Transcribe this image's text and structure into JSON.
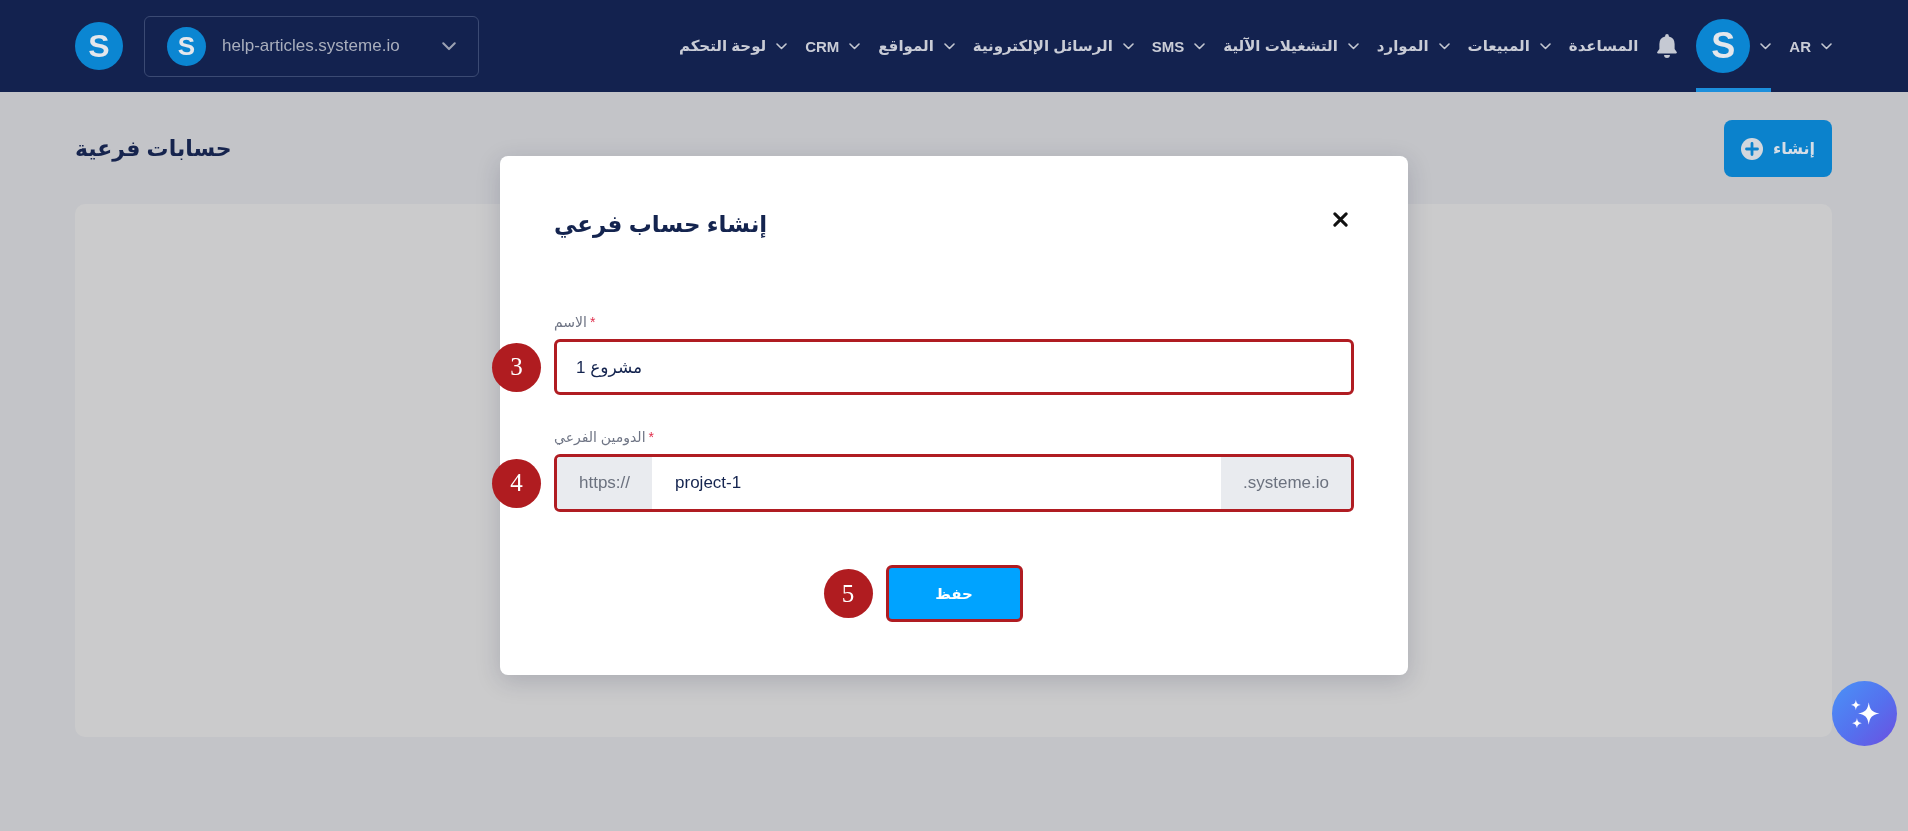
{
  "topbar": {
    "logo": {
      "letter": "S"
    },
    "workspace": {
      "letter": "S",
      "label": "help-articles.systeme.io"
    },
    "nav": [
      {
        "kind": "language",
        "label": "AR",
        "selected": false
      },
      {
        "kind": "avatar",
        "letter": "S",
        "selected": true
      },
      {
        "kind": "bell",
        "selected": false
      },
      {
        "kind": "link",
        "label": "المساعدة",
        "selected": false
      },
      {
        "kind": "dropdown",
        "label": "المبيعات",
        "selected": false
      },
      {
        "kind": "dropdown",
        "label": "الموارد",
        "selected": false
      },
      {
        "kind": "dropdown",
        "label": "التشغيلات الآلية",
        "selected": false
      },
      {
        "kind": "dropdown",
        "label": "SMS",
        "selected": false
      },
      {
        "kind": "dropdown",
        "label": "الرسائل الإلكترونية",
        "selected": false
      },
      {
        "kind": "dropdown",
        "label": "المواقع",
        "selected": false
      },
      {
        "kind": "dropdown",
        "label": "CRM",
        "selected": false
      },
      {
        "kind": "dropdown",
        "label": "لوحة التحكم",
        "selected": false
      }
    ]
  },
  "page": {
    "title": "حسابات فرعية",
    "create_button": {
      "label": "إنشاء"
    }
  },
  "dialog": {
    "title": "إنشاء حساب فرعي",
    "fields": [
      {
        "kind": "text",
        "label": "الاسم",
        "required_mark": "*",
        "value": "مشروع 1",
        "callout": "3"
      },
      {
        "kind": "affixed",
        "label": "الدومين الفرعي",
        "required_mark": "*",
        "prefix": "https://",
        "value": "project-1",
        "suffix": ".systeme.io",
        "callout": "4"
      }
    ],
    "save_button": {
      "label": "حفظ",
      "callout": "5"
    }
  }
}
